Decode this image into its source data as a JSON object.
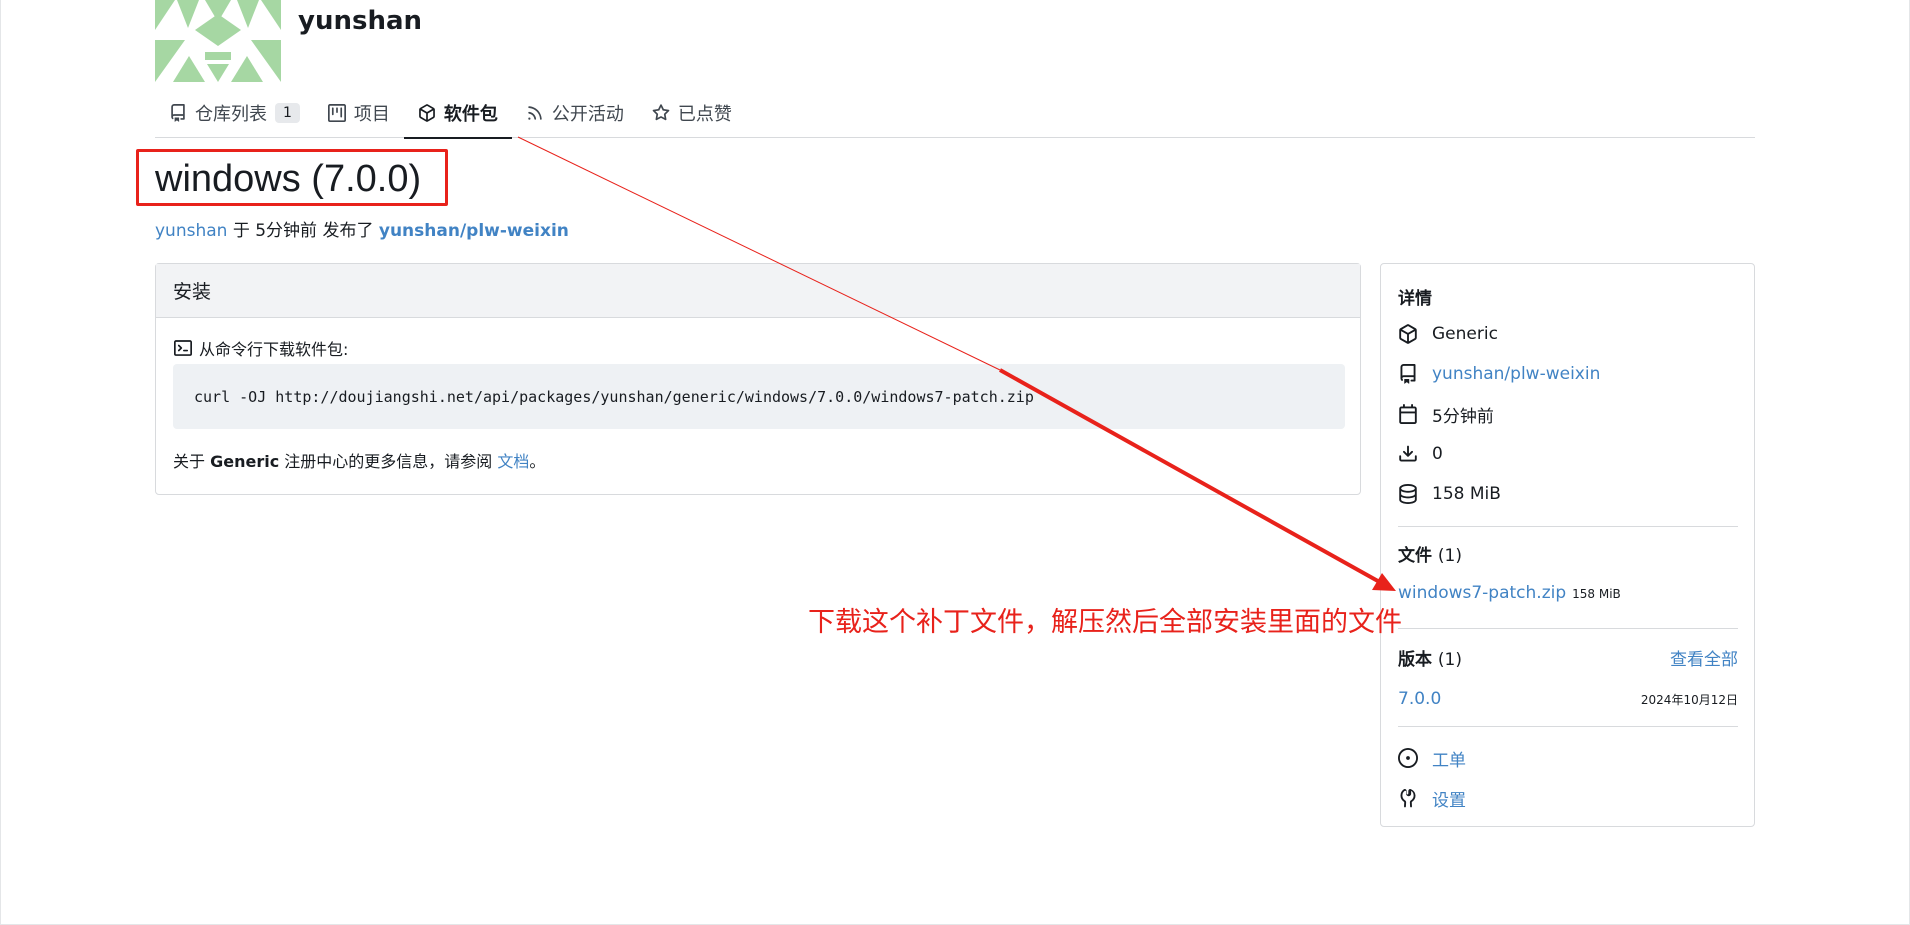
{
  "header": {
    "owner_name": "yunshan"
  },
  "tabs": [
    {
      "label": "仓库列表",
      "count": "1",
      "icon": "repo-icon"
    },
    {
      "label": "项目",
      "icon": "project-icon"
    },
    {
      "label": "软件包",
      "icon": "package-icon",
      "active": true
    },
    {
      "label": "公开活动",
      "icon": "rss-icon"
    },
    {
      "label": "已点赞",
      "icon": "star-icon"
    }
  ],
  "package": {
    "title": "windows (7.0.0)",
    "publisher": "yunshan",
    "mid_text": " 于 5分钟前 发布了 ",
    "repo": "yunshan/plw-weixin"
  },
  "install": {
    "heading": "安装",
    "cli_label": "从命令行下载软件包:",
    "command": "curl -OJ http://doujiangshi.net/api/packages/yunshan/generic/windows/7.0.0/windows7-patch.zip",
    "info_prefix": "关于 ",
    "info_bold": "Generic",
    "info_mid": " 注册中心的更多信息，请参阅 ",
    "info_link": "文档",
    "info_suffix": "。"
  },
  "details": {
    "heading": "详情",
    "type": "Generic",
    "repo": "yunshan/plw-weixin",
    "time": "5分钟前",
    "downloads": "0",
    "size": "158 MiB"
  },
  "files": {
    "heading": "文件",
    "count": "(1)",
    "items": [
      {
        "name": "windows7-patch.zip",
        "size": "158 MiB"
      }
    ]
  },
  "versions": {
    "heading": "版本",
    "count": "(1)",
    "view_all": "查看全部",
    "items": [
      {
        "version": "7.0.0",
        "date": "2024年10月12日"
      }
    ]
  },
  "links": {
    "issues": "工单",
    "settings": "设置"
  },
  "annotation": {
    "text": "下载这个补丁文件，解压然后全部安装里面的文件",
    "color": "#e8221b"
  }
}
